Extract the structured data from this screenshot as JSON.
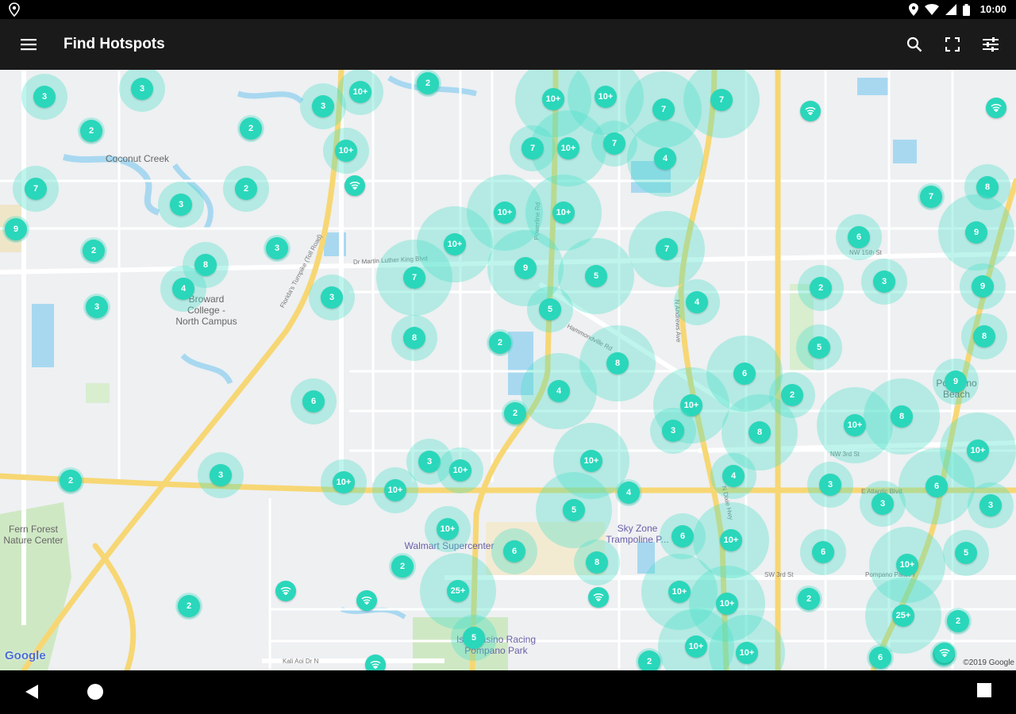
{
  "status_bar": {
    "time": "10:00",
    "left_icon": "location-pin-icon",
    "right_icons": [
      "location-icon",
      "wifi-icon",
      "signal-icon",
      "battery-icon"
    ]
  },
  "app_bar": {
    "title": "Find Hotspots",
    "menu_icon": "hamburger-menu-icon",
    "actions": [
      "search-icon",
      "scan-icon",
      "filter-icon"
    ]
  },
  "colors": {
    "cluster_fill": "#2ad7bb",
    "cluster_halo": "#48e0c8",
    "app_bar": "#1a1a1a",
    "map_bg": "#eef0f2",
    "major_road": "#f7d774",
    "water": "#a8d8f0",
    "park": "#cfe8c4"
  },
  "map": {
    "labels": [
      {
        "text": "Coconut Creek",
        "kind": "place"
      },
      {
        "text": "Broward\nCollege -\nNorth Campus",
        "kind": "place"
      },
      {
        "text": "Fern Forest\nNature Center",
        "kind": "place"
      },
      {
        "text": "Pompano\nBeach",
        "kind": "place"
      },
      {
        "text": "Walmart Supercenter",
        "kind": "business"
      },
      {
        "text": "Sky Zone\nTrampoline P...",
        "kind": "business"
      },
      {
        "text": "Isle Casino Racing\nPompano Park",
        "kind": "business"
      }
    ],
    "road_labels": [
      "Dr Martin Luther King Blvd",
      "NW 15th St",
      "NW 3rd St",
      "E Atlantic Blvd",
      "SW 3rd St",
      "Pompano Park Pl",
      "Kali Aoi Dr N",
      "Florida's Turnpike (Toll Road)",
      "Powerline Rd",
      "Hammondville Rd",
      "N Andrews Ave",
      "N Dixie Hwy"
    ],
    "clusters": [
      {
        "label": "3",
        "size": "m"
      },
      {
        "label": "3",
        "size": "m"
      },
      {
        "label": "2",
        "size": "s"
      },
      {
        "label": "10+",
        "size": "m"
      },
      {
        "label": "3",
        "size": "m"
      },
      {
        "label": "2",
        "size": "s"
      },
      {
        "label": "2",
        "size": "s"
      },
      {
        "label": "10+",
        "size": "l"
      },
      {
        "label": "10+",
        "size": "l"
      },
      {
        "label": "7",
        "size": "l"
      },
      {
        "label": "7",
        "size": "l"
      },
      {
        "label": "10+",
        "size": "l"
      },
      {
        "label": "7",
        "size": "m"
      },
      {
        "label": "7",
        "size": "m"
      },
      {
        "label": "4",
        "size": "l"
      },
      {
        "label": "10+",
        "size": "m"
      },
      {
        "label": "2",
        "size": "m"
      },
      {
        "label": "7",
        "size": "m"
      },
      {
        "label": "3",
        "size": "m"
      },
      {
        "label": "9",
        "size": "s"
      },
      {
        "label": "2",
        "size": "s"
      },
      {
        "label": "3",
        "size": "s"
      },
      {
        "label": "8",
        "size": "m"
      },
      {
        "label": "4",
        "size": "m"
      },
      {
        "label": "3",
        "size": "s"
      },
      {
        "label": "3",
        "size": "m"
      },
      {
        "label": "10+",
        "size": "l"
      },
      {
        "label": "10+",
        "size": "l"
      },
      {
        "label": "10+",
        "size": "l"
      },
      {
        "label": "7",
        "size": "l"
      },
      {
        "label": "9",
        "size": "l"
      },
      {
        "label": "5",
        "size": "l"
      },
      {
        "label": "5",
        "size": "m"
      },
      {
        "label": "8",
        "size": "m"
      },
      {
        "label": "2",
        "size": "s"
      },
      {
        "label": "4",
        "size": "m"
      },
      {
        "label": "7",
        "size": "s"
      },
      {
        "label": "8",
        "size": "m"
      },
      {
        "label": "9",
        "size": "l"
      },
      {
        "label": "6",
        "size": "m"
      },
      {
        "label": "3",
        "size": "m"
      },
      {
        "label": "9",
        "size": "m"
      },
      {
        "label": "2",
        "size": "m"
      },
      {
        "label": "8",
        "size": "m"
      },
      {
        "label": "5",
        "size": "m"
      },
      {
        "label": "7",
        "size": "l"
      },
      {
        "label": "6",
        "size": "l"
      },
      {
        "label": "8",
        "size": "l"
      },
      {
        "label": "4",
        "size": "l"
      },
      {
        "label": "2",
        "size": "s"
      },
      {
        "label": "6",
        "size": "m"
      },
      {
        "label": "2",
        "size": "m"
      },
      {
        "label": "10+",
        "size": "l"
      },
      {
        "label": "3",
        "size": "m"
      },
      {
        "label": "8",
        "size": "l"
      },
      {
        "label": "9",
        "size": "m"
      },
      {
        "label": "10+",
        "size": "l"
      },
      {
        "label": "8",
        "size": "l"
      },
      {
        "label": "10+",
        "size": "l"
      },
      {
        "label": "2",
        "size": "s"
      },
      {
        "label": "3",
        "size": "m"
      },
      {
        "label": "3",
        "size": "m"
      },
      {
        "label": "10+",
        "size": "m"
      },
      {
        "label": "3",
        "size": "m"
      },
      {
        "label": "10+",
        "size": "l"
      },
      {
        "label": "5",
        "size": "l"
      },
      {
        "label": "10+",
        "size": "m"
      },
      {
        "label": "6",
        "size": "l"
      },
      {
        "label": "4",
        "size": "s"
      },
      {
        "label": "4",
        "size": "m"
      },
      {
        "label": "3",
        "size": "m"
      },
      {
        "label": "3",
        "size": "m"
      },
      {
        "label": "10+",
        "size": "m"
      },
      {
        "label": "10+",
        "size": "m"
      },
      {
        "label": "10+",
        "size": "l"
      },
      {
        "label": "6",
        "size": "m"
      },
      {
        "label": "6",
        "size": "m"
      },
      {
        "label": "10+",
        "size": "l"
      },
      {
        "label": "6",
        "size": "m"
      },
      {
        "label": "5",
        "size": "m"
      },
      {
        "label": "2",
        "size": "s"
      },
      {
        "label": "8",
        "size": "m"
      },
      {
        "label": "10+",
        "size": "l"
      },
      {
        "label": "10+",
        "size": "l"
      },
      {
        "label": "25+",
        "size": "l"
      },
      {
        "label": "2",
        "size": "s"
      },
      {
        "label": "25+",
        "size": "l"
      },
      {
        "label": "2",
        "size": "s"
      },
      {
        "label": "5",
        "size": "m"
      },
      {
        "label": "10+",
        "size": "l"
      },
      {
        "label": "10+",
        "size": "l"
      },
      {
        "label": "2",
        "size": "s"
      },
      {
        "label": "2",
        "size": "s"
      },
      {
        "label": "6",
        "size": "s"
      },
      {
        "label": "2",
        "size": "s"
      }
    ],
    "hotspot_icon": "wifi-hotspot-icon",
    "hotspot_count": 8,
    "attribution": "Google",
    "copyright": "©2019 Google"
  },
  "location_button_icon": "my-location-icon",
  "nav_bar": {
    "icons": [
      "back-icon",
      "home-icon",
      "recents-icon"
    ]
  }
}
